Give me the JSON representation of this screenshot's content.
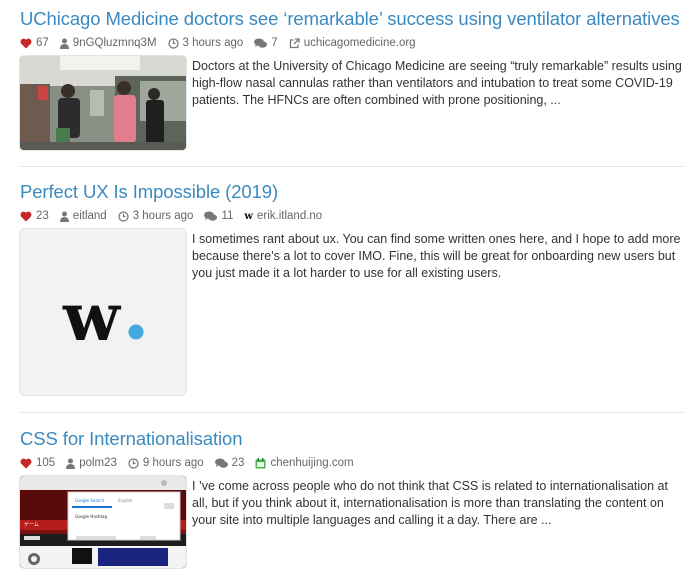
{
  "colors": {
    "link": "#3a8ac0",
    "heart": "#c62828",
    "meta_text": "#666666",
    "w_dot": "#3fa9e0"
  },
  "posts": [
    {
      "title": "UChicago Medicine doctors see ‘remarkable’ success using ventilator alternatives",
      "likes": "67",
      "author": "9nGQluzmnq3M",
      "time": "3 hours ago",
      "comments": "7",
      "source_icon": "external-link-icon",
      "domain": "uchicagomedicine.org",
      "excerpt": "Doctors at the University of Chicago Medicine are seeing “truly remarkable” results using high-flow nasal cannulas rather than ventilators and intubation to treat some COVID-19 patients. The HFNCs are often combined with prone positioning, ..."
    },
    {
      "title": "Perfect UX Is Impossible (2019)",
      "likes": "23",
      "author": "eitland",
      "time": "3 hours ago",
      "comments": "11",
      "source_icon": "w-favicon-icon",
      "domain": "erik.itland.no",
      "thumb_logo": "w",
      "excerpt": "I sometimes rant about ux. You can find some written ones here, and I hope to add more because there's a lot to cover IMO. Fine, this will be great for onboarding new users but you just made it a lot harder to use for all existing users."
    },
    {
      "title": "CSS for Internationalisation",
      "likes": "105",
      "author": "polm23",
      "time": "9 hours ago",
      "comments": "23",
      "source_icon": "calendar-favicon-icon",
      "domain": "chenhuijing.com",
      "thumb_texts": [
        "Google Search",
        "English",
        "Google Hashtag",
        "ゲーム"
      ],
      "excerpt": "I ’ve come across people who do not think that CSS is related to internationalisation at all, but if you think about it, internationalisation is more than translating the content on your site into multiple languages and calling it a day. There are ..."
    }
  ]
}
